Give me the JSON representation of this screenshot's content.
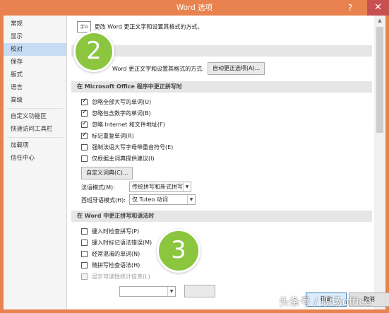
{
  "window": {
    "title": "Word 选项",
    "help_icon": "?",
    "close_icon": "✕"
  },
  "sidebar": {
    "items": [
      {
        "label": "常规"
      },
      {
        "label": "显示"
      },
      {
        "label": "校对",
        "selected": true
      },
      {
        "label": "保存"
      },
      {
        "label": "版式"
      },
      {
        "label": "语言"
      },
      {
        "label": "高级"
      },
      {
        "label": "自定义功能区"
      },
      {
        "label": "快速访问工具栏"
      },
      {
        "label": "加载项"
      },
      {
        "label": "信任中心"
      }
    ]
  },
  "header": {
    "icon_text": "字A",
    "description": "更改 Word 更正文字和设置其格式的方式。"
  },
  "autocorrect": {
    "label": "Word 更正文字和设置其格式的方式:",
    "button": "自动更正选项(A)..."
  },
  "office_section": {
    "title": "在 Microsoft Office 程序中更正拼写时",
    "options": [
      {
        "label": "忽略全部大写的单词(U)",
        "checked": true
      },
      {
        "label": "忽略包含数字的单词(B)",
        "checked": true
      },
      {
        "label": "忽略 Internet 和文件地址(F)",
        "checked": true
      },
      {
        "label": "标记重复单词(R)",
        "checked": true
      },
      {
        "label": "强制法语大写字母带重音符号(E)",
        "checked": false
      },
      {
        "label": "仅根据主词典提供建议(I)",
        "checked": false
      }
    ],
    "custom_dict_button": "自定义词典(C)...",
    "french_mode_label": "法语模式(M):",
    "french_mode_value": "传统拼写和新式拼写",
    "spanish_mode_label": "西班牙语模式(H):",
    "spanish_mode_value": "仅 Tuteo 动词"
  },
  "word_section": {
    "title": "在 Word 中更正拼写和语法时",
    "options": [
      {
        "label": "键入时检查拼写(P)",
        "checked": false
      },
      {
        "label": "键入时标记语法错误(M)",
        "checked": false
      },
      {
        "label": "经常混淆的单词(N)",
        "checked": false
      },
      {
        "label": "随拼写检查语法(H)",
        "checked": false
      },
      {
        "label": "显示可读性统计信息(L)",
        "checked": false,
        "disabled": true
      }
    ]
  },
  "badges": {
    "step2": "2",
    "step3": "3"
  },
  "footer": {
    "ok": "确定",
    "cancel": "取消"
  },
  "watermark": "头条号 / 职场office",
  "colors": {
    "titlebar": "#e8834f",
    "badge": "#8cc63f",
    "selected_nav": "#c5dcf3"
  }
}
